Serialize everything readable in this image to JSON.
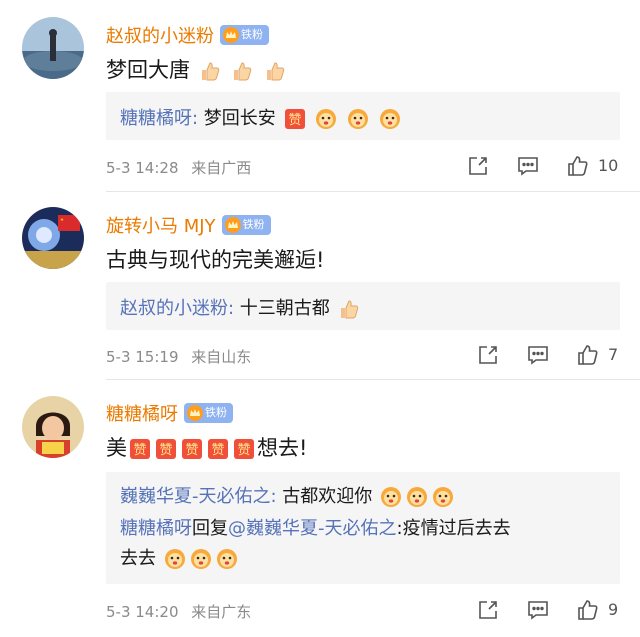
{
  "comments": [
    {
      "username": "赵叔的小迷粉",
      "fan_badge": "铁粉",
      "text": "梦回大唐",
      "emojis": [
        "thumbs-up",
        "thumbs-up",
        "thumbs-up"
      ],
      "replies": [
        {
          "user": "糖糖橘呀",
          "sep": ": ",
          "text": "梦回长安",
          "emojis": [
            "zan",
            "lion",
            "lion",
            "lion"
          ]
        }
      ],
      "date": "5-3 14:28",
      "location": "来自广西",
      "likes": "10"
    },
    {
      "username": "旋转小马 MJY",
      "fan_badge": "铁粉",
      "text": "古典与现代的完美邂逅!",
      "emojis": [],
      "replies": [
        {
          "user": "赵叔的小迷粉",
          "sep": ": ",
          "text": "十三朝古都",
          "emojis": [
            "thumbs-up"
          ]
        }
      ],
      "date": "5-3 15:19",
      "location": "来自山东",
      "likes": "7"
    },
    {
      "username": "糖糖橘呀",
      "fan_badge": "铁粉",
      "text_prefix": "美",
      "text_emojis": [
        "zan",
        "zan",
        "zan",
        "zan",
        "zan"
      ],
      "text_suffix": "想去!",
      "replies": [
        {
          "user": "巍巍华夏-天必佑之",
          "sep": ": ",
          "text": "古都欢迎你",
          "emojis": [
            "lion",
            "lion",
            "lion"
          ]
        },
        {
          "user": "糖糖橘呀",
          "mid": "回复",
          "mention": "@巍巍华夏-天必佑之",
          "sep": ":",
          "text": "疫情过后去去",
          "text_line2": "去去",
          "emojis": [
            "lion",
            "lion",
            "lion"
          ]
        }
      ],
      "date": "5-3 14:20",
      "location": "来自广东",
      "likes": "9"
    }
  ],
  "icons": {
    "share": "share-icon",
    "comment": "comment-icon",
    "like": "like-icon",
    "fan_crown": "crown-icon"
  },
  "colors": {
    "username": "#ea7b00",
    "reply_name": "#5673b9",
    "meta": "#8a8a8a",
    "reply_bg": "#f5f5f5",
    "badge": "#8fb3f0"
  }
}
